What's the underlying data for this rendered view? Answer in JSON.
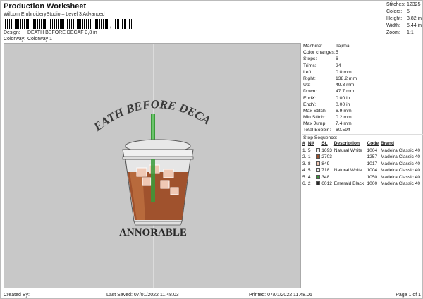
{
  "header": {
    "title": "Production Worksheet",
    "software": "Wilcom EmbroideryStudio – Level 3 Advanced",
    "barcode_end": ","
  },
  "info": {
    "design_label": "Design:",
    "design_value": "DEATH BEFORE DECAF 3,8 in",
    "colorway_label": "Colorway:",
    "colorway_value": "Colorway 1"
  },
  "stats": [
    {
      "k": "Stitches:",
      "v": "12325"
    },
    {
      "k": "Colors:",
      "v": "5"
    },
    {
      "k": "Height:",
      "v": "3.82 in"
    },
    {
      "k": "Width:",
      "v": "5.44 in"
    },
    {
      "k": "Zoom:",
      "v": "1:1"
    }
  ],
  "design": {
    "arc_text": "DEATH BEFORE DECAF",
    "bottom_text": "ANNORABLE"
  },
  "machine": [
    {
      "k": "Machine:",
      "v": "Tajima"
    },
    {
      "k": "Color changes:",
      "v": "5"
    },
    {
      "k": "Stops:",
      "v": "6"
    },
    {
      "k": "Trims:",
      "v": "24"
    },
    {
      "k": "Left:",
      "v": "0.0 mm"
    },
    {
      "k": "Right:",
      "v": "138.2 mm"
    },
    {
      "k": "Up:",
      "v": "49.3 mm"
    },
    {
      "k": "Down:",
      "v": "47.7 mm"
    },
    {
      "k": "EndX:",
      "v": "0.00 in"
    },
    {
      "k": "EndY:",
      "v": "0.00 in"
    },
    {
      "k": "Max Stitch:",
      "v": "6.9 mm"
    },
    {
      "k": "Min Stitch:",
      "v": "0.2 mm"
    },
    {
      "k": "Max Jump:",
      "v": "7.4 mm"
    },
    {
      "k": "Total Bobbin:",
      "v": "60.59ft"
    }
  ],
  "sequence": {
    "title": "Stop Sequence:",
    "headers": [
      "#",
      "N#",
      "St.",
      "Description",
      "Code",
      "Brand"
    ],
    "rows": [
      {
        "n": "1.",
        "nn": "5",
        "color": "#f2f2f2",
        "st": "1693",
        "desc": "Natural White",
        "code": "1004",
        "brand": "Madeira Classic 40"
      },
      {
        "n": "2.",
        "nn": "1",
        "color": "#a0522d",
        "st": "2703",
        "desc": "",
        "code": "1257",
        "brand": "Madeira Classic 40"
      },
      {
        "n": "3.",
        "nn": "8",
        "color": "#f0c8b4",
        "st": "849",
        "desc": "",
        "code": "1017",
        "brand": "Madeira Classic 40"
      },
      {
        "n": "4.",
        "nn": "5",
        "color": "#f2f2f2",
        "st": "718",
        "desc": "Natural White",
        "code": "1004",
        "brand": "Madeira Classic 40"
      },
      {
        "n": "5.",
        "nn": "4",
        "color": "#3a9a3a",
        "st": "348",
        "desc": "",
        "code": "1050",
        "brand": "Madeira Classic 40"
      },
      {
        "n": "6.",
        "nn": "2",
        "color": "#2a2a2a",
        "st": "6012",
        "desc": "Emerald Black",
        "code": "1000",
        "brand": "Madeira Classic 40"
      }
    ]
  },
  "footer": {
    "created": "Created By:",
    "saved": "Last Saved: 07/01/2022 11.48.03",
    "printed": "Printed: 07/01/2022 11.48.06",
    "page": "Page 1 of 1"
  }
}
